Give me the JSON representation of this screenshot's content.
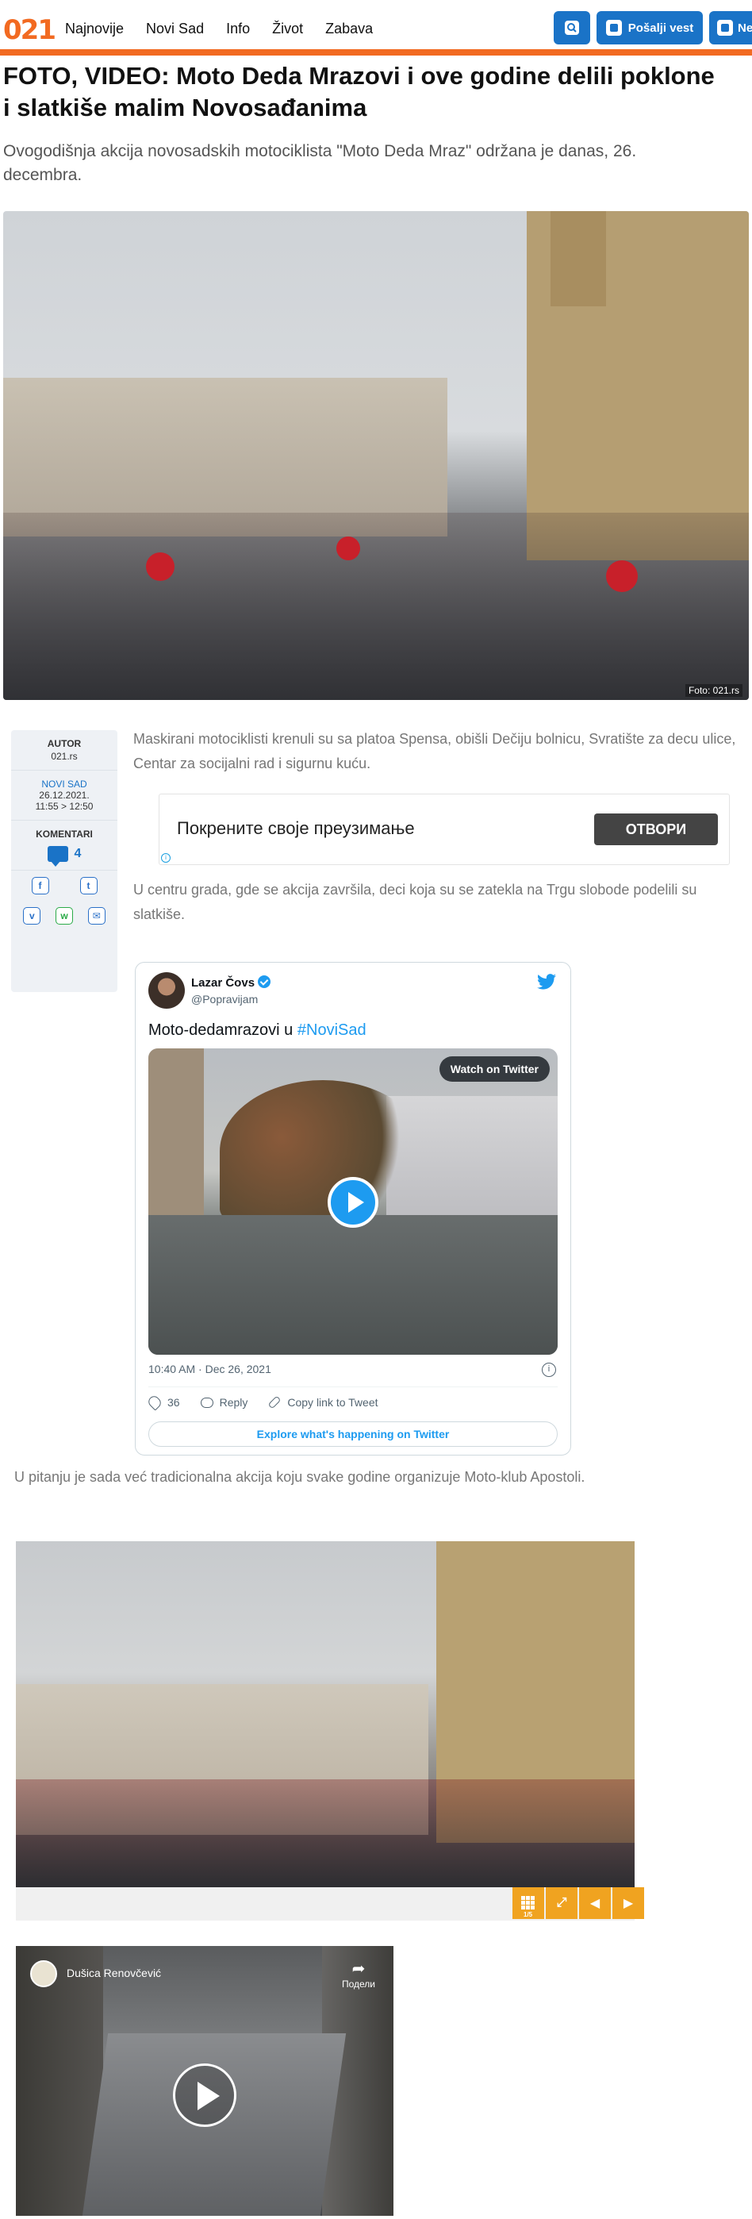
{
  "header": {
    "logo": "021",
    "nav": [
      "Najnovije",
      "Novi Sad",
      "Info",
      "Život",
      "Zabava"
    ],
    "send_news_label": "Pošalji vest",
    "cut_button_label": "Ne",
    "accent_color": "#f26a21",
    "button_color": "#1a73c7"
  },
  "article": {
    "title": "FOTO, VIDEO: Moto Deda Mrazovi i ove godine delili poklone i slatkiše malim Novosađanima",
    "lead": "Ovogodišnja akcija novosadskih motociklista \"Moto Deda Mraz\" održana je danas, 26. decembra.",
    "photo_caption": "Foto: 021.rs",
    "p1": "Maskirani motociklisti krenuli su sa platoa Spensa, obišli Dečiju bolnicu, Svratište za decu ulice, Centar za socijalni rad i sigurnu kuću.",
    "p2": "U centru grada, gde se akcija završila, deci koja su se zatekla na Trgu slobode podelili su slatkiše.",
    "p3": "U pitanju je sada već tradicionalna akcija koju svake godine organizuje Moto-klub Apostoli."
  },
  "meta": {
    "author_label": "AUTOR",
    "author": "021.rs",
    "location": "NOVI SAD",
    "date": "26.12.2021.",
    "time": "11:55 > 12:50",
    "comments_label": "KOMENTARI",
    "comments_count": "4"
  },
  "ad": {
    "text": "Покрените своје преузимање",
    "button": "ОТВОРИ"
  },
  "tweet": {
    "name": "Lazar Čovs",
    "handle": "@Popravijam",
    "text": "Moto-dedamrazovi u ",
    "hashtag": "#NoviSad",
    "watch_label": "Watch on Twitter",
    "timestamp": "10:40 AM · Dec 26, 2021",
    "likes": "36",
    "reply_label": "Reply",
    "copy_label": "Copy link to Tweet",
    "explore_label": "Explore what's happening on Twitter"
  },
  "gallery": {
    "counter": "1/5",
    "accent_color": "#f0a320"
  },
  "fb_video": {
    "author": "Dušica Renovčević",
    "share_label": "Подели"
  }
}
